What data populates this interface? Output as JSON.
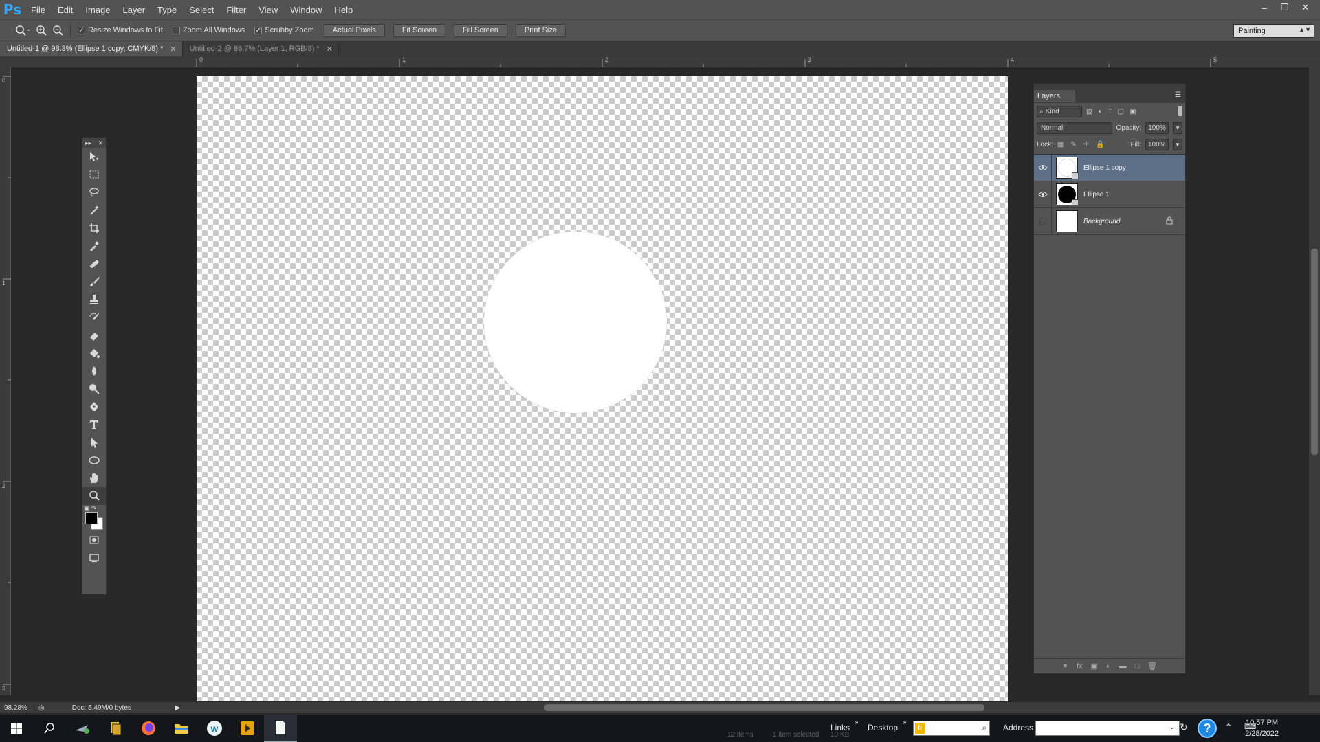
{
  "app": {
    "logo": "Ps"
  },
  "menu": [
    "File",
    "Edit",
    "Image",
    "Layer",
    "Type",
    "Select",
    "Filter",
    "View",
    "Window",
    "Help"
  ],
  "options": {
    "resize_windows": "Resize Windows to Fit",
    "zoom_all": "Zoom All Windows",
    "scrubby_zoom": "Scrubby Zoom",
    "resize_checked": true,
    "zoom_all_checked": false,
    "scrubby_checked": true,
    "buttons": [
      "Actual Pixels",
      "Fit Screen",
      "Fill Screen",
      "Print Size"
    ],
    "workspace": "Painting"
  },
  "tabs": [
    {
      "label": "Untitled-1 @ 98.3% (Ellipse 1 copy, CMYK/8) *",
      "active": true
    },
    {
      "label": "Untitled-2 @ 66.7% (Layer 1, RGB/8) *",
      "active": false
    }
  ],
  "ruler": {
    "top": [
      "0",
      "1",
      "2",
      "3",
      "4",
      "5"
    ],
    "left": [
      "0",
      "1",
      "2",
      "3"
    ]
  },
  "status": {
    "zoom": "98.28%",
    "doc": "Doc: 5.49M/0 bytes"
  },
  "layers_panel": {
    "title": "Layers",
    "filter": "Kind",
    "blend_mode": "Normal",
    "opacity_label": "Opacity:",
    "opacity": "100%",
    "lock_label": "Lock:",
    "fill_label": "Fill:",
    "fill": "100%",
    "layers": [
      {
        "name": "Ellipse 1 copy",
        "visible": true,
        "selected": true
      },
      {
        "name": "Ellipse 1",
        "visible": true,
        "selected": false
      },
      {
        "name": "Background",
        "visible": false,
        "selected": false,
        "locked": true
      }
    ]
  },
  "taskbar": {
    "links": "Links",
    "desktop": "Desktop",
    "address": "Address",
    "time": "10:57 PM",
    "date": "2/28/2022",
    "explorer_status": [
      "12 items",
      "1 item selected",
      "10 KB"
    ]
  },
  "colors": {
    "accent": "#31a8ff",
    "selected_layer": "#5d6f87",
    "panel": "#535353",
    "foreground": "#000000",
    "background": "#ffffff"
  }
}
